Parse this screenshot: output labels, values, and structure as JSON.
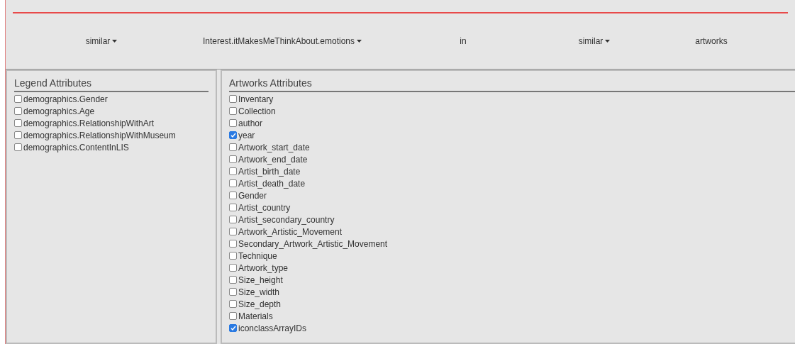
{
  "query": [
    {
      "kind": "dropdown",
      "label": "similar"
    },
    {
      "kind": "dropdown",
      "label": "Interest.itMakesMeThinkAbout.emotions"
    },
    {
      "kind": "text",
      "label": "in"
    },
    {
      "kind": "dropdown",
      "label": "similar"
    },
    {
      "kind": "text",
      "label": "artworks"
    }
  ],
  "legend_panel": {
    "title": "Legend Attributes",
    "items": [
      {
        "label": "demographics.Gender",
        "checked": false
      },
      {
        "label": "demographics.Age",
        "checked": false
      },
      {
        "label": "demographics.RelationshipWithArt",
        "checked": false
      },
      {
        "label": "demographics.RelationshipWithMuseum",
        "checked": false
      },
      {
        "label": "demographics.ContentInLIS",
        "checked": false
      }
    ]
  },
  "artworks_panel": {
    "title": "Artworks Attributes",
    "items": [
      {
        "label": "Inventary",
        "checked": false
      },
      {
        "label": "Collection",
        "checked": false
      },
      {
        "label": "author",
        "checked": false
      },
      {
        "label": "year",
        "checked": true
      },
      {
        "label": "Artwork_start_date",
        "checked": false
      },
      {
        "label": "Artwork_end_date",
        "checked": false
      },
      {
        "label": "Artist_birth_date",
        "checked": false
      },
      {
        "label": "Artist_death_date",
        "checked": false
      },
      {
        "label": "Gender",
        "checked": false
      },
      {
        "label": "Artist_country",
        "checked": false
      },
      {
        "label": "Artist_secondary_country",
        "checked": false
      },
      {
        "label": "Artwork_Artistic_Movement",
        "checked": false
      },
      {
        "label": "Secondary_Artwork_Artistic_Movement",
        "checked": false
      },
      {
        "label": "Technique",
        "checked": false
      },
      {
        "label": "Artwork_type",
        "checked": false
      },
      {
        "label": "Size_height",
        "checked": false
      },
      {
        "label": "Size_width",
        "checked": false
      },
      {
        "label": "Size_depth",
        "checked": false
      },
      {
        "label": "Materials",
        "checked": false
      },
      {
        "label": "iconclassArrayIDs",
        "checked": true
      }
    ]
  }
}
